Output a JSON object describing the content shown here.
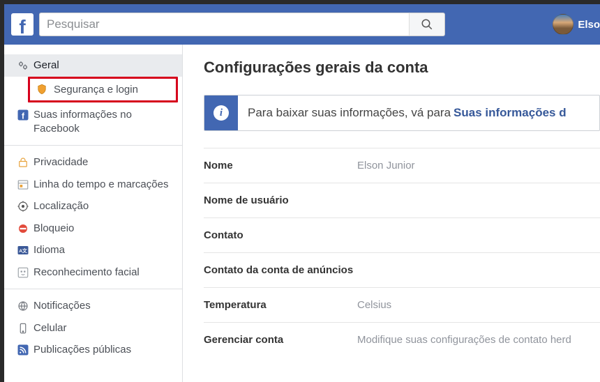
{
  "topbar": {
    "search_placeholder": "Pesquisar",
    "user_name": "Elso"
  },
  "sidebar": {
    "group1": [
      {
        "label": "Geral",
        "icon": "gears-icon",
        "active": true
      },
      {
        "label": "Segurança e login",
        "icon": "shield-icon",
        "highlight": true
      },
      {
        "label": "Suas informações no Facebook",
        "icon": "fb-square-icon"
      }
    ],
    "group2": [
      {
        "label": "Privacidade",
        "icon": "lock-icon"
      },
      {
        "label": "Linha do tempo e marcações",
        "icon": "timeline-icon"
      },
      {
        "label": "Localização",
        "icon": "location-icon"
      },
      {
        "label": "Bloqueio",
        "icon": "block-icon"
      },
      {
        "label": "Idioma",
        "icon": "language-icon"
      },
      {
        "label": "Reconhecimento facial",
        "icon": "face-icon"
      }
    ],
    "group3": [
      {
        "label": "Notificações",
        "icon": "globe-icon"
      },
      {
        "label": "Celular",
        "icon": "mobile-icon"
      },
      {
        "label": "Publicações públicas",
        "icon": "rss-icon"
      }
    ]
  },
  "main": {
    "title": "Configurações gerais da conta",
    "notice_text": "Para baixar suas informações, vá para",
    "notice_link": "Suas informações d",
    "rows": [
      {
        "key": "Nome",
        "val": "Elson Junior"
      },
      {
        "key": "Nome de usuário",
        "val": ""
      },
      {
        "key": "Contato",
        "val": ""
      },
      {
        "key": "Contato da conta de anúncios",
        "val": ""
      },
      {
        "key": "Temperatura",
        "val": "Celsius"
      },
      {
        "key": "Gerenciar conta",
        "val": "Modifique suas configurações de contato herd"
      }
    ]
  }
}
